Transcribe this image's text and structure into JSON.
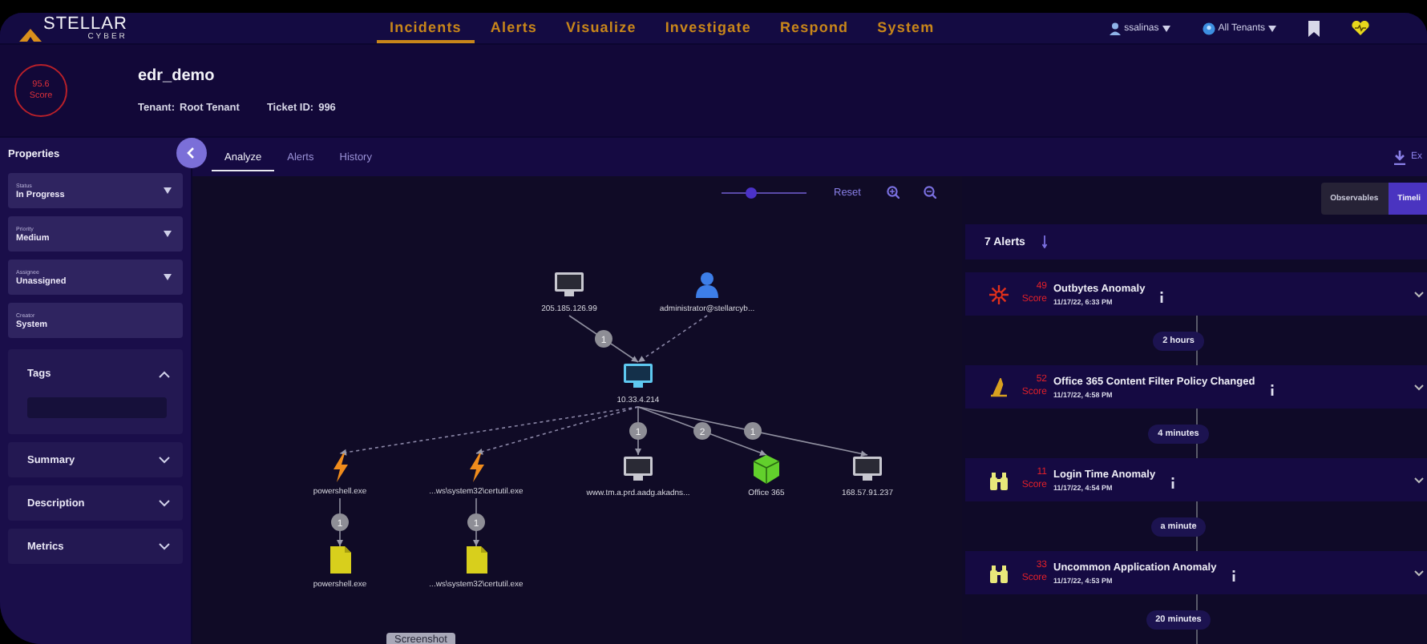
{
  "header": {
    "logo": {
      "name": "STELLAR",
      "sub": "CYBER"
    },
    "nav": [
      {
        "label": "Incidents",
        "selected": true
      },
      {
        "label": "Alerts",
        "selected": false
      },
      {
        "label": "Visualize",
        "selected": false
      },
      {
        "label": "Investigate",
        "selected": false
      },
      {
        "label": "Respond",
        "selected": false
      },
      {
        "label": "System",
        "selected": false
      }
    ],
    "user": "ssalinas",
    "tenant_menu": "All Tenants"
  },
  "incident": {
    "score": "95.6",
    "score_label": "Score",
    "title": "edr_demo",
    "tenant_label": "Tenant:",
    "tenant": "Root Tenant",
    "ticket_label": "Ticket ID:",
    "ticket": "996"
  },
  "tabs": [
    {
      "label": "Analyze",
      "selected": true
    },
    {
      "label": "Alerts",
      "selected": false
    },
    {
      "label": "History",
      "selected": false
    }
  ],
  "export": "Ex",
  "sidebar": {
    "title": "Properties",
    "fields": [
      {
        "label": "Status",
        "value": "In Progress",
        "dropdown": true
      },
      {
        "label": "Priority",
        "value": "Medium",
        "dropdown": true
      },
      {
        "label": "Assignee",
        "value": "Unassigned",
        "dropdown": true
      },
      {
        "label": "Creator",
        "value": "System",
        "dropdown": false
      }
    ],
    "sections": [
      {
        "title": "Tags",
        "expanded": true
      },
      {
        "title": "Summary",
        "expanded": false
      },
      {
        "title": "Description",
        "expanded": false
      },
      {
        "title": "Metrics",
        "expanded": false
      }
    ]
  },
  "graph": {
    "reset": "Reset",
    "zoom": {
      "level": 0.3
    },
    "nodes": [
      {
        "kind": "monitor",
        "label": "205.185.126.99"
      },
      {
        "kind": "user",
        "label": "administrator@stellarcyb..."
      },
      {
        "kind": "host",
        "label": "10.33.4.214"
      },
      {
        "kind": "process",
        "label": "powershell.exe"
      },
      {
        "kind": "process",
        "label": "...ws\\system32\\certutil.exe"
      },
      {
        "kind": "monitor",
        "label": "www.tm.a.prd.aadg.akadns..."
      },
      {
        "kind": "app",
        "label": "Office 365"
      },
      {
        "kind": "monitor",
        "label": "168.57.91.237"
      },
      {
        "kind": "file",
        "label": "powershell.exe"
      },
      {
        "kind": "file",
        "label": "...ws\\system32\\certutil.exe"
      }
    ],
    "edges": [
      {
        "kind": "solid",
        "count": "1"
      },
      {
        "kind": "dashed"
      },
      {
        "kind": "dashed"
      },
      {
        "kind": "dashed"
      },
      {
        "kind": "solid",
        "count": "1"
      },
      {
        "kind": "solid",
        "count": "2"
      },
      {
        "kind": "solid",
        "count": "1"
      },
      {
        "kind": "solid",
        "count": "1"
      },
      {
        "kind": "solid",
        "count": "1"
      }
    ],
    "screenshot": "Screenshot"
  },
  "alerts_panel": {
    "view_toggle": [
      {
        "label": "Observables",
        "selected": false
      },
      {
        "label": "Timeli",
        "selected": true
      }
    ],
    "count": "7 Alerts",
    "timeline": [
      {
        "kind": "burst",
        "score": "49",
        "score_label": "Score",
        "title": "Outbytes Anomaly",
        "time": "11/17/22, 6:33 PM"
      },
      {
        "kind": "gap",
        "label": "2 hours"
      },
      {
        "kind": "hat",
        "score": "52",
        "score_label": "Score",
        "title": "Office 365 Content Filter Policy Changed",
        "time": "11/17/22, 4:58 PM"
      },
      {
        "kind": "gap",
        "label": "4 minutes"
      },
      {
        "kind": "binoculars",
        "score": "11",
        "score_label": "Score",
        "title": "Login Time Anomaly",
        "time": "11/17/22, 4:54 PM"
      },
      {
        "kind": "gap",
        "label": "a minute"
      },
      {
        "kind": "binoculars",
        "score": "33",
        "score_label": "Score",
        "title": "Uncommon Application Anomaly",
        "time": "11/17/22, 4:53 PM"
      },
      {
        "kind": "gap",
        "label": "20 minutes"
      }
    ]
  }
}
